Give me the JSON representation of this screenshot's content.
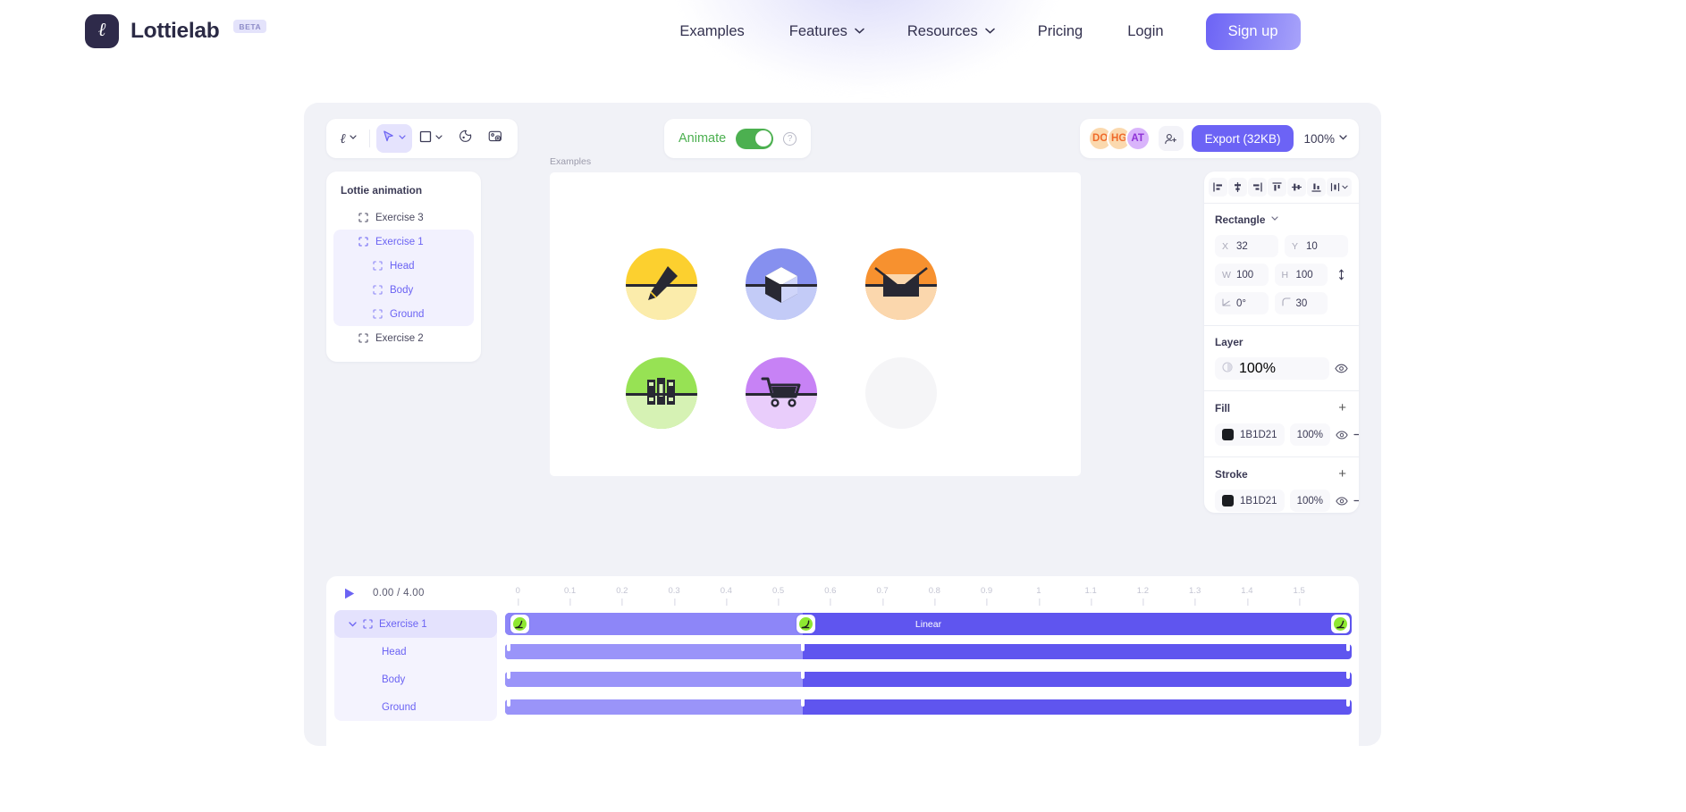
{
  "site": {
    "brand_name": "Lottielab",
    "brand_badge": "BETA",
    "brand_mark_icon": "lottielab-script-l-icon",
    "nav": [
      {
        "label": "Examples",
        "has_dropdown": false,
        "name": "nav-examples"
      },
      {
        "label": "Features",
        "has_dropdown": true,
        "name": "nav-features"
      },
      {
        "label": "Resources",
        "has_dropdown": true,
        "name": "nav-resources"
      },
      {
        "label": "Pricing",
        "has_dropdown": false,
        "name": "nav-pricing"
      },
      {
        "label": "Login",
        "has_dropdown": false,
        "name": "nav-login"
      }
    ],
    "signup_label": "Sign up",
    "accent": "#6c63f5"
  },
  "editor": {
    "toolbar": {
      "tools": [
        {
          "name": "pen-tool",
          "icon": "script-l-icon",
          "caret": true,
          "active": false
        },
        {
          "name": "select-tool",
          "icon": "cursor-arrow-icon",
          "caret": true,
          "active": true
        },
        {
          "name": "shape-tool",
          "icon": "square-icon",
          "caret": true,
          "active": false
        },
        {
          "name": "asset-tool",
          "icon": "sticker-icon",
          "caret": false,
          "active": false
        },
        {
          "name": "add-image-tool",
          "icon": "image-plus-icon",
          "caret": false,
          "active": false
        }
      ]
    },
    "animate": {
      "label": "Animate",
      "toggle_on": true,
      "help_icon": "question-circle-icon",
      "on_color": "#4cb050"
    },
    "collaborators": [
      {
        "initials": "DO",
        "bg": "#fbd9ae",
        "fg": "#ef6a2a"
      },
      {
        "initials": "HG",
        "bg": "#fbd9ae",
        "fg": "#ef6a2a"
      },
      {
        "initials": "AT",
        "bg": "#d9b4fb",
        "fg": "#8e32d6"
      }
    ],
    "invite_icon": "add-user-icon",
    "export_label": "Export (32KB)",
    "zoom_label": "100%",
    "layers": {
      "title": "Lottie animation",
      "items": [
        {
          "label": "Exercise 3",
          "depth": 0,
          "selected": false,
          "icon": "frame-icon"
        },
        {
          "label": "Exercise 1",
          "depth": 0,
          "selected": true,
          "icon": "frame-icon"
        },
        {
          "label": "Head",
          "depth": 1,
          "selected": true,
          "icon": "frame-icon"
        },
        {
          "label": "Body",
          "depth": 1,
          "selected": true,
          "icon": "frame-icon"
        },
        {
          "label": "Ground",
          "depth": 1,
          "selected": true,
          "icon": "frame-icon"
        },
        {
          "label": "Exercise 2",
          "depth": 0,
          "selected": false,
          "icon": "frame-icon"
        }
      ]
    },
    "canvas": {
      "label": "Examples",
      "icons": [
        {
          "name": "pencil-icon",
          "circle": "#fcd02f",
          "lower": "#fbecab"
        },
        {
          "name": "cube-icon",
          "circle": "#8690ef",
          "lower": "#c3cbf7"
        },
        {
          "name": "envelope-icon",
          "circle": "#f7912f",
          "lower": "#fbd7ad"
        },
        {
          "name": "books-icon",
          "circle": "#97e254",
          "lower": "#d6f2b4"
        },
        {
          "name": "shopping-cart-icon",
          "circle": "#c782f5",
          "lower": "#e9cdfb"
        },
        {
          "name": "empty-placeholder-icon",
          "circle": "#f5f5f7",
          "lower": "#f5f5f7"
        }
      ]
    },
    "properties": {
      "align_buttons": [
        "align-left-icon",
        "align-center-horizontal-icon",
        "align-right-icon",
        "align-top-icon",
        "align-center-vertical-icon",
        "align-bottom-icon",
        "distribute-icon"
      ],
      "shape": {
        "name": "Rectangle",
        "caret_icon": "chevron-down-icon"
      },
      "transform": {
        "x_key": "X",
        "x_value": "32",
        "y_key": "Y",
        "y_value": "10",
        "w_key": "W",
        "w_value": "100",
        "h_key": "H",
        "h_value": "100",
        "rotation_value": "0°",
        "radius_value": "30",
        "link_icon": "link-ratio-icon",
        "rotation_icon": "angle-icon",
        "radius_icon": "corner-radius-icon"
      },
      "layer": {
        "title": "Layer",
        "opacity": "100%",
        "opacity_icon": "opacity-icon",
        "eye_icon": "eye-icon"
      },
      "fill": {
        "title": "Fill",
        "add_icon": "plus-icon",
        "color_hex": "1B1D21",
        "swatch": "#1b1d21",
        "opacity": "100%",
        "eye_icon": "eye-icon",
        "remove_icon": "minus-icon"
      },
      "stroke": {
        "title": "Stroke",
        "add_icon": "plus-icon",
        "color_hex": "1B1D21",
        "swatch": "#1b1d21",
        "opacity": "100%",
        "eye_icon": "eye-icon",
        "remove_icon": "minus-icon"
      }
    },
    "timeline": {
      "play_icon": "play-icon",
      "current_time": "0.00",
      "separator": "/",
      "total_time": "4.00",
      "ruler_ticks": [
        "0",
        "0.1",
        "0.2",
        "0.3",
        "0.4",
        "0.5",
        "0.6",
        "0.7",
        "0.8",
        "0.9",
        "1",
        "1.1",
        "1.2",
        "1.3",
        "1.4",
        "1.5"
      ],
      "rows": [
        {
          "label": "Exercise 1",
          "type": "group",
          "expanded": true,
          "chevron_icon": "chevron-down-icon",
          "frame_icon": "frame-icon",
          "easing_label": "Linear",
          "keyframes": [
            {
              "pos_pct": 2.2,
              "icon": "easing-marker-icon"
            },
            {
              "pos_pct": 36,
              "icon": "easing-marker-icon"
            },
            {
              "pos_pct": 99.2,
              "icon": "easing-marker-icon"
            }
          ]
        },
        {
          "label": "Head",
          "type": "layer",
          "split_pct": 35.2,
          "handles_pct": [
            0.3,
            35.2,
            99.4
          ]
        },
        {
          "label": "Body",
          "type": "layer",
          "split_pct": 35.2,
          "handles_pct": [
            0.3,
            35.2,
            99.4
          ]
        },
        {
          "label": "Ground",
          "type": "layer",
          "split_pct": 35.2,
          "handles_pct": [
            0.3,
            35.2,
            99.4
          ]
        }
      ]
    }
  }
}
